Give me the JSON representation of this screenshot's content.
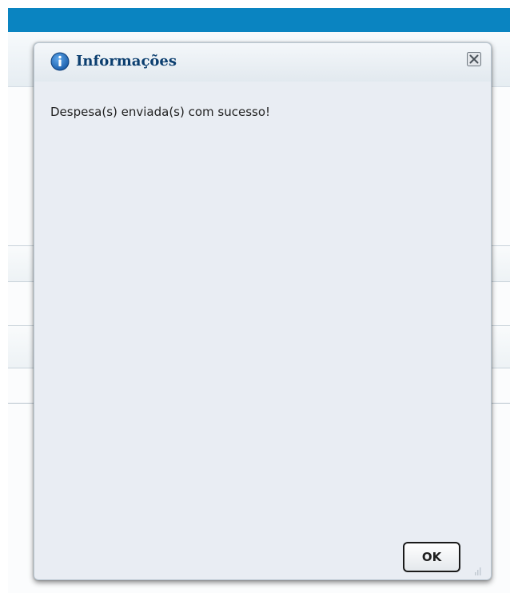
{
  "dialog": {
    "title": "Informações",
    "message": "Despesa(s) enviada(s) com sucesso!",
    "ok_label": "OK",
    "icons": {
      "info": "info-icon",
      "close": "close-icon",
      "resize": "resize-grip-icon"
    }
  },
  "colors": {
    "top_bar": "#0a84c1",
    "title_text": "#0b3e6f",
    "info_icon": "#1e73c8",
    "dialog_body": "#e9edf3"
  }
}
